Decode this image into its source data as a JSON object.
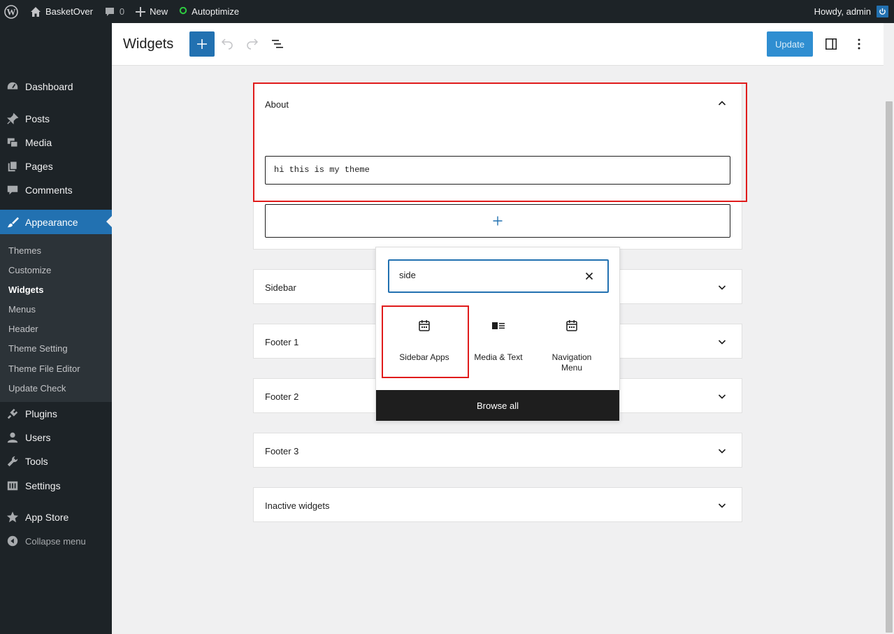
{
  "adminbar": {
    "site_name": "BasketOver",
    "comments_count": "0",
    "new_label": "New",
    "plugin_label": "Autoptimize",
    "greeting": "Howdy, admin"
  },
  "menu": {
    "items": [
      {
        "label": "Dashboard",
        "icon": "dashboard-icon"
      },
      {
        "label": "Posts",
        "icon": "pin-icon"
      },
      {
        "label": "Media",
        "icon": "media-icon"
      },
      {
        "label": "Pages",
        "icon": "pages-icon"
      },
      {
        "label": "Comments",
        "icon": "comment-icon"
      },
      {
        "label": "Appearance",
        "icon": "brush-icon"
      },
      {
        "label": "Plugins",
        "icon": "plugin-icon"
      },
      {
        "label": "Users",
        "icon": "user-icon"
      },
      {
        "label": "Tools",
        "icon": "wrench-icon"
      },
      {
        "label": "Settings",
        "icon": "settings-icon"
      },
      {
        "label": "App Store",
        "icon": "star-icon"
      },
      {
        "label": "Collapse menu",
        "icon": "collapse-icon"
      }
    ],
    "submenu": [
      "Themes",
      "Customize",
      "Widgets",
      "Menus",
      "Header",
      "Theme Setting",
      "Theme File Editor",
      "Update Check"
    ]
  },
  "header": {
    "title": "Widgets",
    "update_label": "Update"
  },
  "widget_areas": [
    {
      "title": "About",
      "expanded": true,
      "paragraph": "hi this is my theme"
    },
    {
      "title": "Sidebar"
    },
    {
      "title": "Footer 1"
    },
    {
      "title": "Footer 2"
    },
    {
      "title": "Footer 3"
    },
    {
      "title": "Inactive widgets"
    }
  ],
  "inserter": {
    "search_value": "side",
    "results": [
      {
        "label": "Sidebar Apps",
        "icon": "calendar-icon"
      },
      {
        "label": "Media & Text",
        "icon": "media-text-icon"
      },
      {
        "label": "Navigation Menu",
        "icon": "calendar-icon"
      }
    ],
    "browse_all": "Browse all"
  },
  "colors": {
    "admin_dark": "#1d2327",
    "accent": "#2271b1",
    "highlight": "#e01b1b"
  }
}
